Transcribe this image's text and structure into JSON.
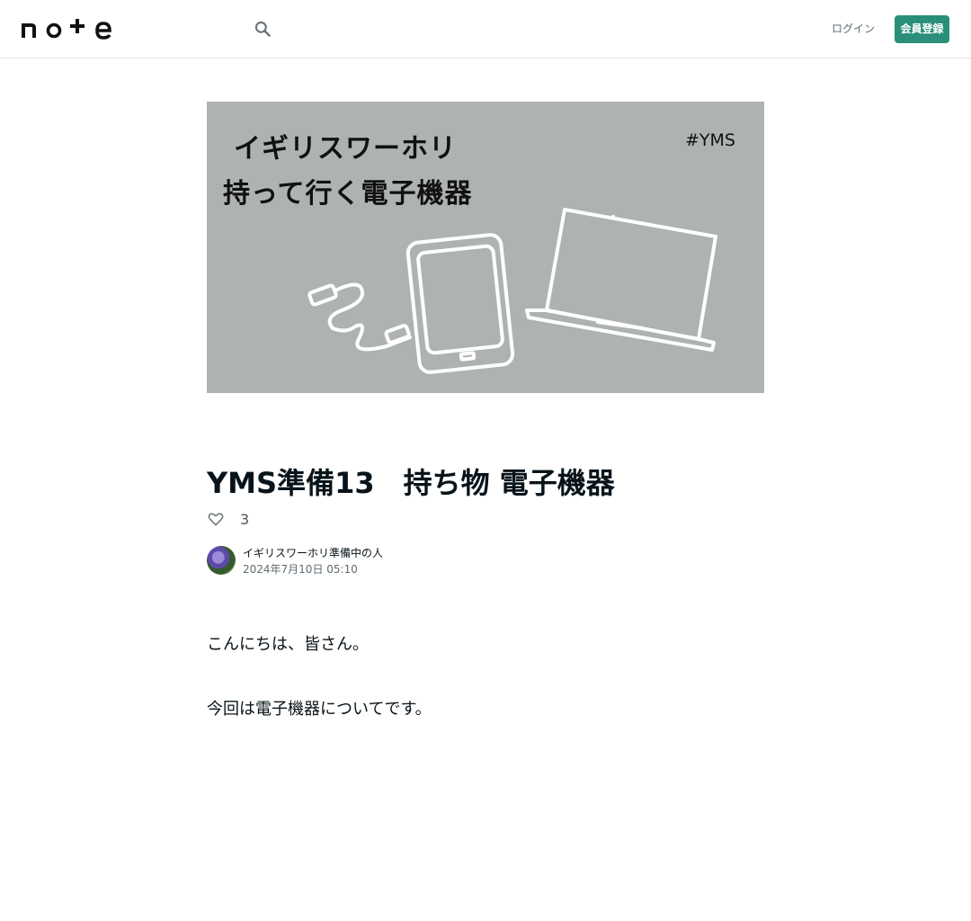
{
  "header": {
    "logo_text": "note",
    "login_label": "ログイン",
    "signup_label": "会員登録",
    "accent_color": "#2a8f7a"
  },
  "hero": {
    "title_line1": "イギリスワーホリ",
    "title_line2": "持って行く電子機器",
    "tag": "#YMS",
    "background_color": "#aeb3b2"
  },
  "article": {
    "title": "YMS準備13　持ち物 電子機器",
    "like_count": "3",
    "author_name": "イギリスワーホリ準備中の人",
    "post_date": "2024年7月10日 05:10",
    "paragraphs": [
      "こんにちは、皆さん。",
      "今回は電子機器についてです。"
    ]
  },
  "icons": {
    "search": "search-icon",
    "like": "heart-icon"
  }
}
